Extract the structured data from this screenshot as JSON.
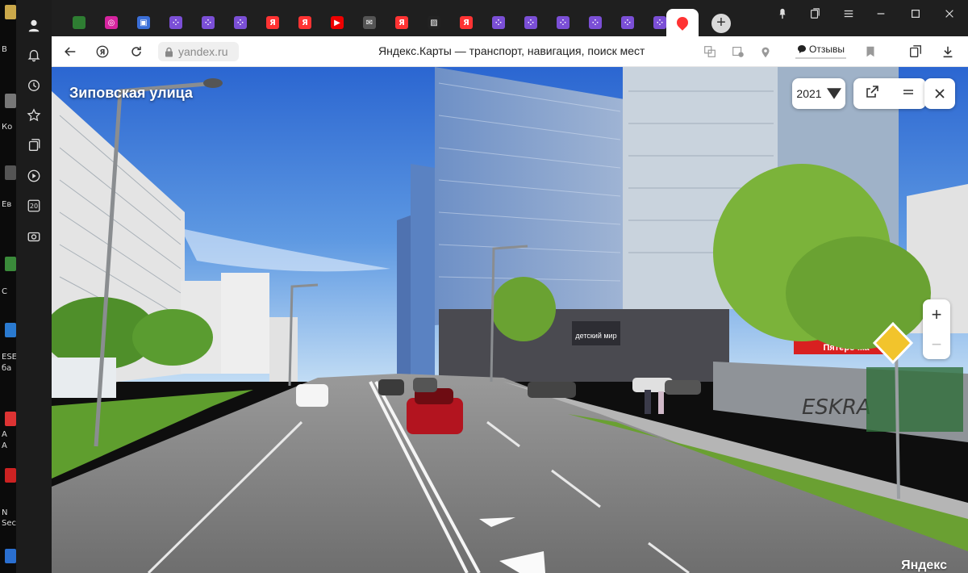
{
  "desktop": {
    "labels": [
      "В",
      "Ко",
      "Ев",
      "С",
      "ESE",
      "ба",
      "А",
      "А",
      "N",
      "Sec"
    ]
  },
  "sidepanel": {
    "items": [
      {
        "name": "profile-icon"
      },
      {
        "name": "bell-icon"
      },
      {
        "name": "history-icon"
      },
      {
        "name": "star-icon"
      },
      {
        "name": "collections-icon"
      },
      {
        "name": "play-icon"
      },
      {
        "name": "zen-icon",
        "label": "20"
      },
      {
        "name": "screenshot-icon"
      }
    ]
  },
  "tabs": [
    {
      "icon": "image-favicon",
      "color": "#2e7d32",
      "glyph": ""
    },
    {
      "icon": "instagram-favicon",
      "color": "#d6249f",
      "glyph": "◎"
    },
    {
      "icon": "photo-favicon",
      "color": "#3b6fd8",
      "glyph": "▣"
    },
    {
      "icon": "grid-favicon",
      "color": "#7b4fd6",
      "glyph": "⁘"
    },
    {
      "icon": "grid-favicon",
      "color": "#7b4fd6",
      "glyph": "⁘"
    },
    {
      "icon": "grid-favicon",
      "color": "#7b4fd6",
      "glyph": "⁘"
    },
    {
      "icon": "yandex-favicon",
      "color": "#f33",
      "glyph": "Я"
    },
    {
      "icon": "yandex-favicon",
      "color": "#f33",
      "glyph": "Я"
    },
    {
      "icon": "youtube-favicon",
      "color": "#e00",
      "glyph": "▶"
    },
    {
      "icon": "mask-favicon",
      "color": "#555",
      "glyph": "✉"
    },
    {
      "icon": "yandex-favicon",
      "color": "#f33",
      "glyph": "Я"
    },
    {
      "icon": "stripes-favicon",
      "color": "#222",
      "glyph": "▨"
    },
    {
      "icon": "yandex-favicon",
      "color": "#f33",
      "glyph": "Я"
    },
    {
      "icon": "grid-favicon",
      "color": "#7b4fd6",
      "glyph": "⁘"
    },
    {
      "icon": "grid-favicon",
      "color": "#7b4fd6",
      "glyph": "⁘"
    },
    {
      "icon": "grid-favicon",
      "color": "#7b4fd6",
      "glyph": "⁘"
    },
    {
      "icon": "grid-favicon",
      "color": "#7b4fd6",
      "glyph": "⁘"
    },
    {
      "icon": "grid-favicon",
      "color": "#7b4fd6",
      "glyph": "⁘"
    },
    {
      "icon": "grid-favicon",
      "color": "#7b4fd6",
      "glyph": "⁘"
    },
    {
      "icon": "maps-pin-favicon",
      "color": "#f33",
      "glyph": "📍",
      "active": true
    }
  ],
  "toolbar": {
    "url": "yandex.ru",
    "title": "Яндекс.Карты — транспорт, навигация, поиск мест",
    "reviews_label": "Отзывы"
  },
  "panorama": {
    "street_name": "Зиповская улица",
    "year": "2021",
    "zoom_in": "+",
    "zoom_out": "−",
    "watermark": "Яндекс",
    "store_sign_1": "детский мир",
    "store_sign_2": "Пятёрочка",
    "graffiti": "ESKRA"
  },
  "colors": {
    "sky_top": "#2f6fd6",
    "sky_bottom": "#a9cdf2",
    "road": "#7a7a7a",
    "grass": "#5f9e2e",
    "accent": "#f33"
  }
}
